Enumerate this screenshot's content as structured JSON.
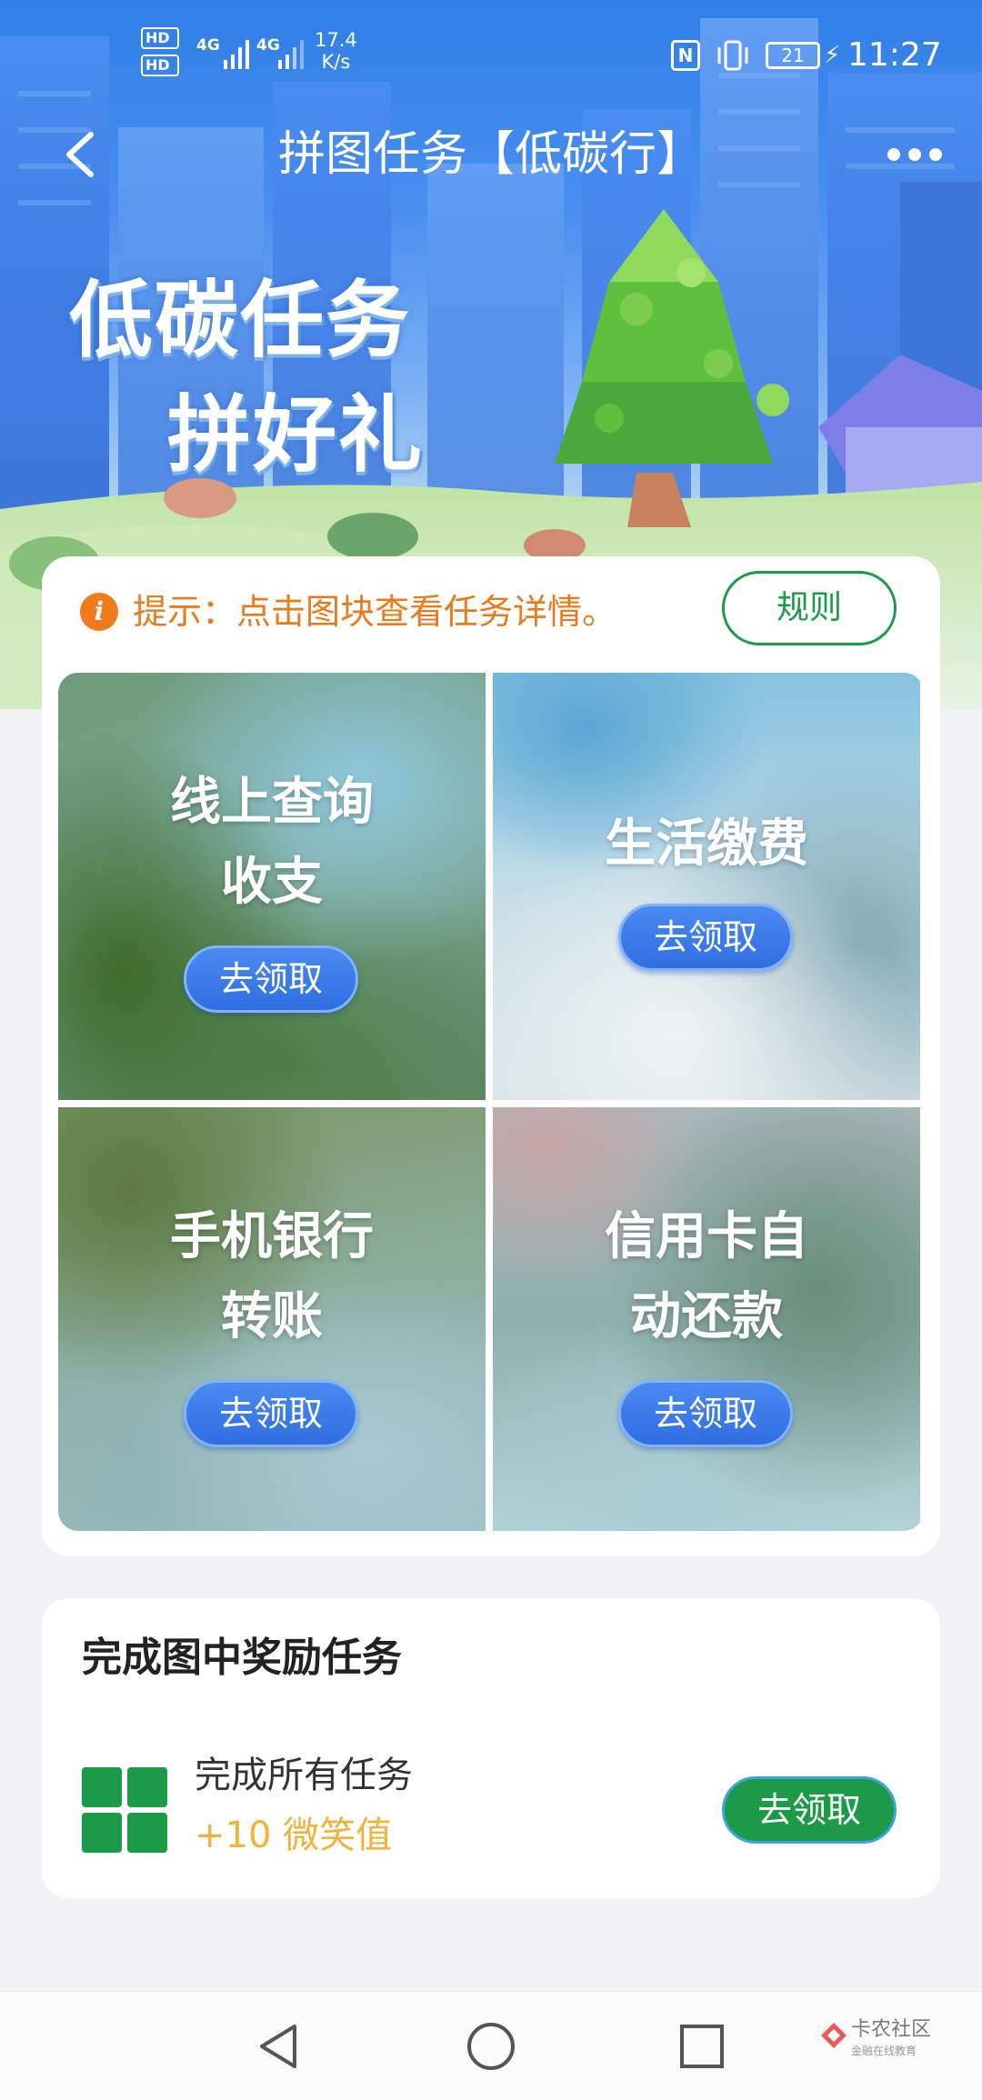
{
  "status_bar": {
    "hd1": "HD",
    "hd2": "HD",
    "net1": "4G",
    "net2": "4G",
    "speed_value": "17.4",
    "speed_unit": "K/s",
    "nfc": "N",
    "battery": "21",
    "time": "11:27"
  },
  "header": {
    "title": "拼图任务【低碳行】"
  },
  "banner": {
    "line1": "低碳任务",
    "line2": "拼好礼"
  },
  "puzzle": {
    "tip": "提示：点击图块查看任务详情。",
    "rules_label": "规则",
    "tiles": [
      {
        "title_line1": "线上查询",
        "title_line2": "收支",
        "button": "去领取"
      },
      {
        "title_line1": "生活缴费",
        "title_line2": "",
        "button": "去领取"
      },
      {
        "title_line1": "手机银行",
        "title_line2": "转账",
        "button": "去领取"
      },
      {
        "title_line1": "信用卡自",
        "title_line2": "动还款",
        "button": "去领取"
      }
    ]
  },
  "reward": {
    "title": "完成图中奖励任务",
    "task": "完成所有任务",
    "points": "+10 微笑值",
    "button": "去领取"
  },
  "watermark": {
    "name": "卡农社区",
    "sub": "金融在线教育"
  },
  "colors": {
    "brand_green": "#1d9a47",
    "tip_orange": "#ea7a1e",
    "claim_blue": "#2f6ee0",
    "points_gold": "#efb23a"
  },
  "icons": {
    "back": "chevron-left-icon",
    "more": "more-dots-icon",
    "tip": "info-icon",
    "reward": "grid-icon",
    "nav_back": "triangle-back-icon",
    "nav_home": "circle-home-icon",
    "nav_recent": "square-recent-icon"
  }
}
